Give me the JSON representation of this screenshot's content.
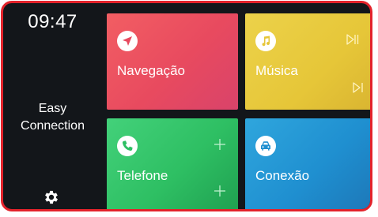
{
  "sidebar": {
    "time": "09:47",
    "brand_line1": "Easy",
    "brand_line2": "Connection",
    "settings_icon": "gear-icon"
  },
  "tiles": [
    {
      "label": "Navegação",
      "icon": "navigation-arrow-icon",
      "color": "#e84a5f"
    },
    {
      "label": "Música",
      "icon": "music-note-icon",
      "color": "#e6c638"
    },
    {
      "label": "Telefone",
      "icon": "phone-icon",
      "color": "#2ebf63"
    },
    {
      "label": "Conexão",
      "icon": "car-icon",
      "color": "#1f8fd0"
    }
  ],
  "colors": {
    "frame_border": "#e3232b",
    "background": "#13161a"
  }
}
